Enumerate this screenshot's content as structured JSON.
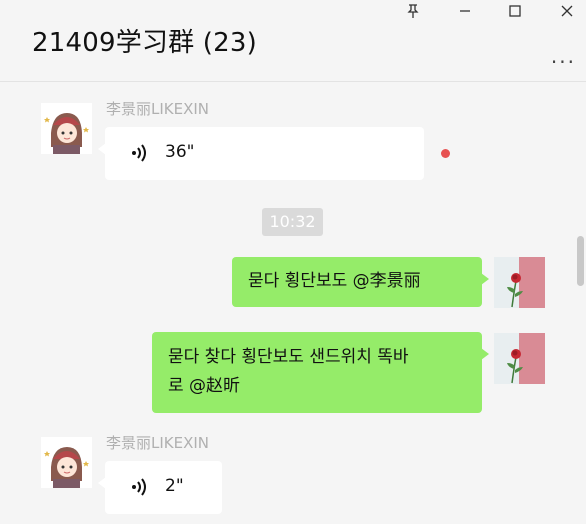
{
  "window": {
    "title": "21409学习群 (23)",
    "controls": [
      "pin-icon",
      "minimize-icon",
      "maximize-icon",
      "close-icon"
    ],
    "more_menu": "..."
  },
  "messages": [
    {
      "type": "voice",
      "direction": "incoming",
      "sender": "李景丽LIKEXIN",
      "duration": "36\"",
      "unread": true
    },
    {
      "type": "timestamp",
      "text": "10:32"
    },
    {
      "type": "text",
      "direction": "outgoing",
      "text": "묻다 횡단보도 @李景丽"
    },
    {
      "type": "text",
      "direction": "outgoing",
      "lines": [
        "묻다 찾다  횡단보도 샌드위치 똑바",
        "로 @赵昕"
      ]
    },
    {
      "type": "voice",
      "direction": "incoming",
      "sender": "李景丽LIKEXIN",
      "duration": "2\"",
      "unread": false
    }
  ],
  "colors": {
    "background": "#f5f5f5",
    "outgoing_bubble": "#95ec69",
    "incoming_bubble": "#ffffff",
    "unread_dot": "#e75151"
  }
}
